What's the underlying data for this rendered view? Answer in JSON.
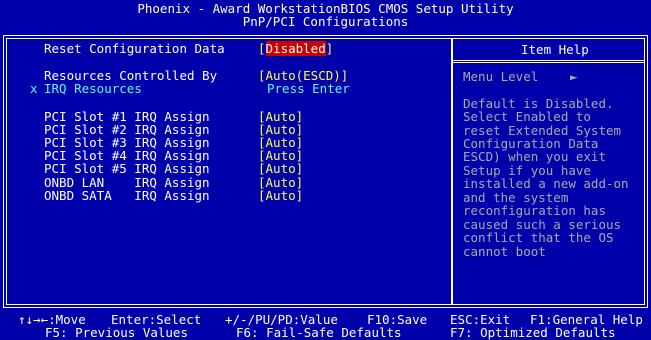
{
  "header": {
    "title": "Phoenix - Award WorkstationBIOS CMOS Setup Utility",
    "subtitle": "PnP/PCI Configurations"
  },
  "settings": {
    "reset_config": {
      "label": "Reset Configuration Data",
      "value_open": "[",
      "value": "Disabled",
      "value_close": "]"
    },
    "resources": {
      "label": "Resources Controlled By",
      "value": "[Auto(ESCD)]"
    },
    "irq_resources": {
      "marker": "x",
      "label": "IRQ Resources",
      "value": "Press Enter"
    },
    "irq_rows": [
      {
        "label": "PCI Slot #1 IRQ Assign",
        "value": "[Auto]"
      },
      {
        "label": "PCI Slot #2 IRQ Assign",
        "value": "[Auto]"
      },
      {
        "label": "PCI Slot #3 IRQ Assign",
        "value": "[Auto]"
      },
      {
        "label": "PCI Slot #4 IRQ Assign",
        "value": "[Auto]"
      },
      {
        "label": "PCI Slot #5 IRQ Assign",
        "value": "[Auto]"
      },
      {
        "label": "ONBD LAN    IRQ Assign",
        "value": "[Auto]"
      },
      {
        "label": "ONBD SATA   IRQ Assign",
        "value": "[Auto]"
      }
    ]
  },
  "help": {
    "title": "Item Help",
    "menu_level": "Menu Level",
    "menu_level_arrow": "►",
    "lines": [
      "Default is Disabled.",
      "Select Enabled to",
      "reset Extended System",
      "Configuration Data",
      "ESCD) when you exit",
      "Setup if you have",
      "installed a new add-on",
      "and the system",
      "reconfiguration has",
      "caused such a serious",
      "conflict that the OS",
      "cannot boot"
    ]
  },
  "footer": {
    "row1": [
      "↑↓→←:Move",
      "Enter:Select",
      "+/-/PU/PD:Value",
      "F10:Save",
      "ESC:Exit",
      "F1:General Help"
    ],
    "row2": [
      "F5: Previous Values",
      "F6: Fail-Safe Defaults",
      "F7: Optimized Defaults"
    ]
  },
  "colors": {
    "background": "#0000aa",
    "selected_bg": "#cc0000",
    "value_yellow": "#ffff55",
    "disabled_cyan": "#55ffff"
  }
}
